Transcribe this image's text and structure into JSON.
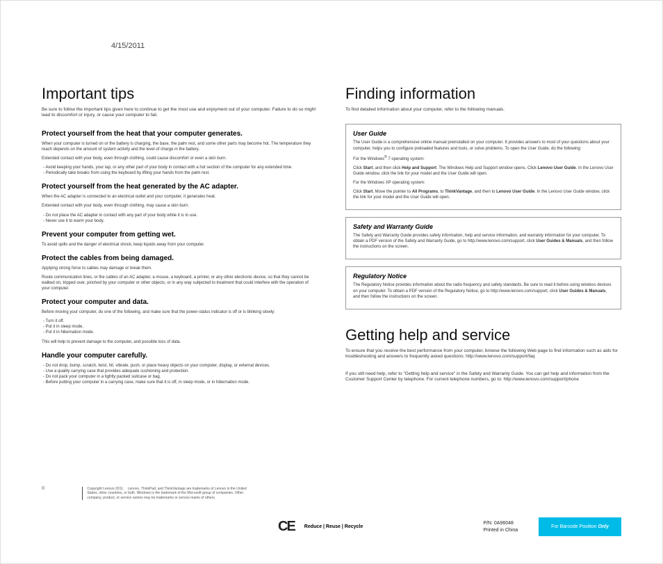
{
  "date": "4/15/2011",
  "left": {
    "title": "Important tips",
    "intro": "Be sure to follow the important tips given here to continue to get the most use and enjoyment out of your computer. Failure to do so might lead to discomfort or injury, or cause your computer to fail.",
    "s1": {
      "h": "Protect yourself from the heat that your computer generates.",
      "p1": "When your computer is turned on or the battery is charging, the base, the palm rest, and some other parts may become hot. The temperature they reach depends on the amount of system activity and the level of charge in the battery.",
      "p2": "Extended contact with your body, even through clothing, could cause discomfort or even a skin burn.",
      "l1": "- Avoid keeping your hands, your lap, or any other part of your body in contact with a hot section of the computer for any extended time.",
      "l2": "- Periodically take breaks from using the keyboard by lifting your hands from the palm rest."
    },
    "s2": {
      "h": "Protect yourself from the heat generated by the AC adapter.",
      "p1": "When the AC adapter is connected to an electrical outlet and your computer, it generates heat.",
      "p2": "Extended contact with your body, even through clothing, may cause a skin burn.",
      "l1": "- Do not place the AC adapter in contact with any part of your body while it is in use.",
      "l2": "- Never use it to warm your body."
    },
    "s3": {
      "h": "Prevent your computer from getting wet.",
      "p1": "To avoid spills and the danger of electrical shock, keep liquids away from your computer."
    },
    "s4": {
      "h": "Protect the cables from being damaged.",
      "p1": "Applying strong force to cables may damage or break them.",
      "p2": "Route communication lines, or the cables of an AC adapter, a mouse, a keyboard, a printer, or any other electronic device, so that they cannot be walked on, tripped over, pinched by your computer or other objects, or in any way subjected to treatment that could interfere with the operation of your computer."
    },
    "s5": {
      "h": "Protect your computer and data.",
      "p1": "Before moving your computer, do one of the following, and make sure that the power-status indicator is off or is blinking slowly:",
      "l1": "- Turn it off.",
      "l2": "- Put it in sleep mode.",
      "l3": "- Put it in hibernation mode.",
      "p2": "This will help to prevent damage to the computer, and possible loss of data."
    },
    "s6": {
      "h": "Handle your computer carefully.",
      "l1": "- Do not drop, bump, scratch, twist, hit, vibrate, push, or place heavy objects on your computer, display, or external devices.",
      "l2": "- Use a quality carrying case that provides adequate cushioning and protection.",
      "l3": "- Do not pack your computer in a tightly packed suitcase or bag.",
      "l4": "- Before putting your computer in a carrying case, make sure that it is off, in sleep mode, or in hibernation mode."
    }
  },
  "right1": {
    "title": "Finding information",
    "intro": "To find detailed information about your computer, refer to the following manuals.",
    "box1": {
      "h": "User Guide",
      "p1": "The User Guide is a comprehensive online manual preinstalled on your computer. It provides answers to most of your questions about your computer, helps you to configure preloaded features and tools, or solve problems. To open the User Guide, do the following:",
      "p2a": "For the Windows",
      "p2b": " 7 operating system:",
      "p3a": "Click ",
      "p3b": "Start",
      "p3c": ", and then click ",
      "p3d": "Help and Support",
      "p3e": ". The Windows Help and Support window opens. Click ",
      "p3f": "Lenovo User Guide",
      "p3g": ". In the Lenovo User Guide window, click the link for your model and the User Guide will open.",
      "p4": "For the Windows XP operating system:",
      "p5a": "Click ",
      "p5b": "Start",
      "p5c": ". Move the pointer to ",
      "p5d": "All Programs",
      "p5e": ", to ",
      "p5f": "ThinkVantage",
      "p5g": ", and then to ",
      "p5h": "Lenovo User Guide",
      "p5i": ". In the Lenovo User Guide window, click the link for your model and the User Guide will open."
    },
    "box2": {
      "h": "Safety and Warranty Guide",
      "p1a": "The Safety and Warranty Guide provides safety information, help and service information, and warranty information for your computer. To obtain a PDF version of the Safety and Warranty Guide, go to http://www.lenovo.com/support, click ",
      "p1b": "User Guides & Manuals",
      "p1c": ", and then follow the instructions on the screen."
    },
    "box3": {
      "h": "Regulatory Notice",
      "p1a": "The Regulatory Notice provides information about the radio frequency and safety standards. Be sure to read it before using wireless devices on your computer. To obtain a PDF version of the Regulatory Notice, go to http://www.lenovo.com/support, click ",
      "p1b": "User Guides & Manuals",
      "p1c": ", and then follow the instructions on the screen."
    }
  },
  "right2": {
    "title": "Getting help and service",
    "p1": "To ensure that you receive the best performance from your computer, browse the following Web page to find information such as aids for troubleshooting and answers to frequently asked questions: http://www.lenovo.com/support/faq",
    "p2": "If you still need help, refer to \"Getting help and service\" in the Safety and Warranty Guide. You can get help and information from the Customer Support Center by telephone. For current telephone numbers, go to: http://www.lenovo.com/support/phone"
  },
  "footer": {
    "copyright": "Copyright Lenovo 2011.",
    "legal": "Lenovo, ThinkPad, and ThinkVantage are trademarks of Lenovo in the United States, other countries, or both. Windows is the trademark of the Microsoft group of companies. Other company, product, or service names may be trademarks or service marks of others.",
    "reduce": "Reduce | Reuse | Recycle",
    "pn": "P/N: 0A96048",
    "printed": "Printed in China",
    "barcode_prefix": "For Barcode Position ",
    "barcode_only": "Only"
  }
}
